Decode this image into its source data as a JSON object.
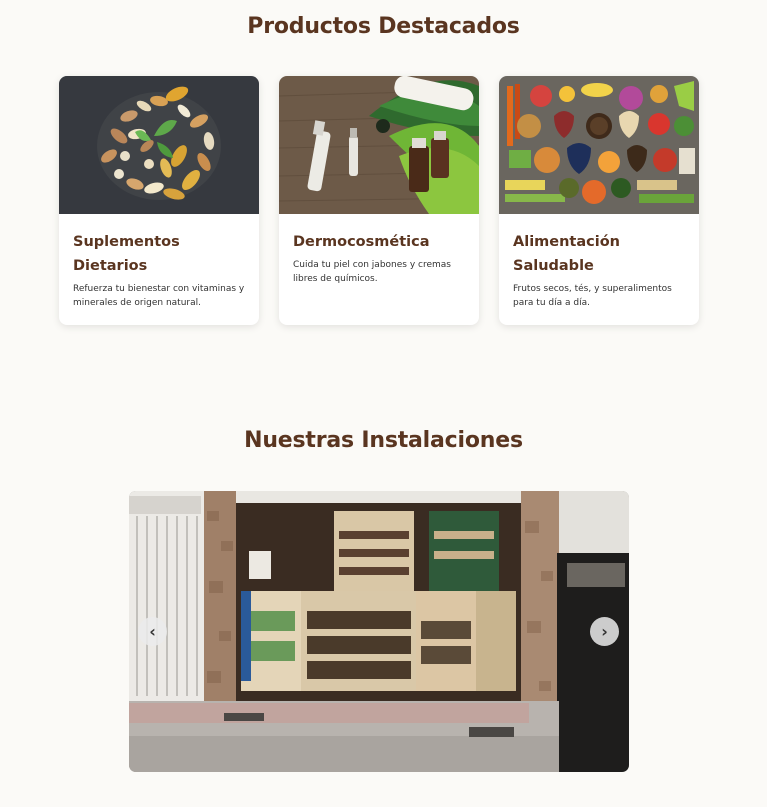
{
  "products": {
    "heading": "Productos Destacados",
    "cards": [
      {
        "title": "Suplementos Dietarios",
        "description": "Refuerza tu bienestar con vitaminas y minerales de origen natural.",
        "image_icon": "supplements-photo"
      },
      {
        "title": "Dermocosmética",
        "description": "Cuida tu piel con jabones y cremas libres de químicos.",
        "image_icon": "cosmetics-photo"
      },
      {
        "title": "Alimentación Saludable",
        "description": "Frutos secos, tés, y superalimentos para tu día a día.",
        "image_icon": "healthy-food-photo"
      }
    ]
  },
  "facilities": {
    "heading": "Nuestras Instalaciones",
    "prev_icon": "‹",
    "next_icon": "›"
  },
  "colors": {
    "background": "#fbfaf7",
    "heading": "#5a3520",
    "text": "#333333"
  }
}
